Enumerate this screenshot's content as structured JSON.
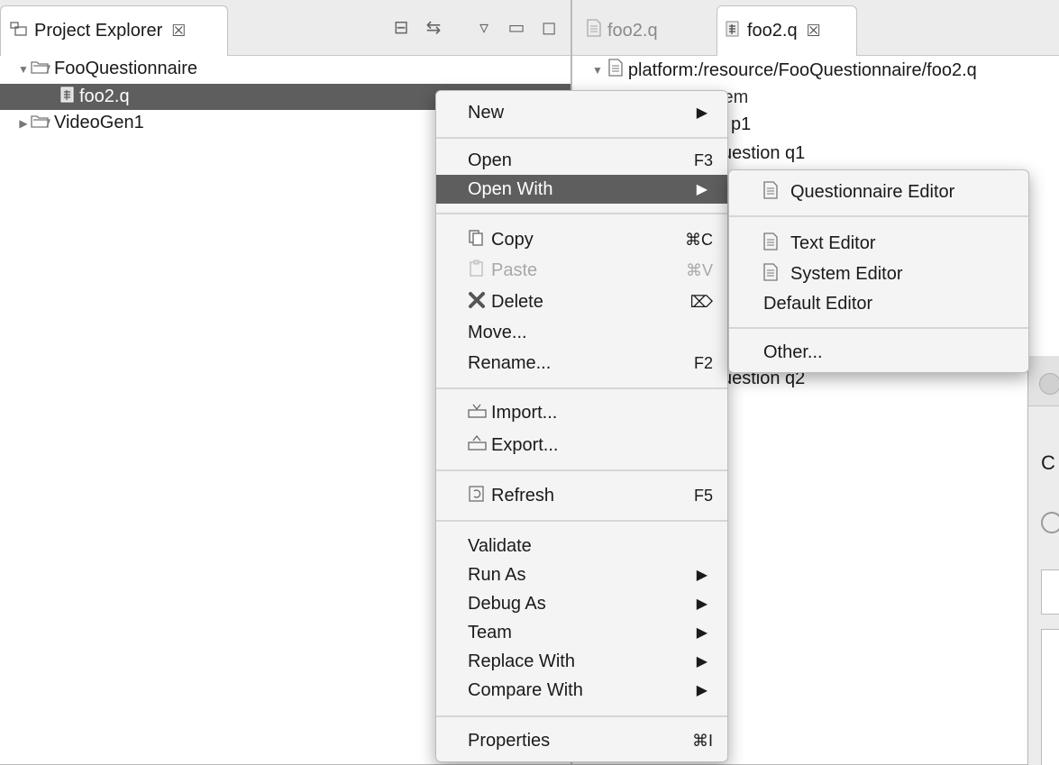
{
  "project_explorer": {
    "tab_label": "Project Explorer",
    "tab_close": "☒",
    "toolbar": {
      "collapse_all": "⊟",
      "link_with_editor": "⇆",
      "view_menu": "▿",
      "minimize": "▭",
      "maximize": "◻"
    },
    "tree": [
      {
        "label": "FooQuestionnaire",
        "arrow": "▼",
        "icon": "folder-icon"
      },
      {
        "label": "foo2.q",
        "icon": "questionnaire-file-icon",
        "selected": true
      },
      {
        "label": "VideoGen1",
        "arrow": "▶",
        "icon": "folder-icon"
      }
    ]
  },
  "editor": {
    "tabs": [
      {
        "label": "foo2.q",
        "active": false
      },
      {
        "label": "foo2.q",
        "active": true,
        "close": "☒"
      }
    ],
    "tree": {
      "root": {
        "arrow": "▼",
        "label": "platform:/resource/FooQuestionnaire/foo2.q"
      },
      "system_fragment": "stem",
      "p1_fragment": "p1",
      "q1_fragment": "uestion q1",
      "q2_fragment": "uestion q2"
    }
  },
  "context_menu": {
    "items": {
      "new": {
        "label": "New",
        "submenu": "▶"
      },
      "open": {
        "label": "Open",
        "shortcut": "F3"
      },
      "open_with": {
        "label": "Open With",
        "submenu": "▶"
      },
      "copy": {
        "label": "Copy",
        "shortcut": "⌘C",
        "icon": "copy-icon"
      },
      "paste": {
        "label": "Paste",
        "shortcut": "⌘V",
        "icon": "paste-icon"
      },
      "delete": {
        "label": "Delete",
        "shortcut": "⌦",
        "icon": "delete-icon"
      },
      "move": {
        "label": "Move..."
      },
      "rename": {
        "label": "Rename...",
        "shortcut": "F2"
      },
      "import": {
        "label": "Import...",
        "icon": "import-icon"
      },
      "export": {
        "label": "Export...",
        "icon": "export-icon"
      },
      "refresh": {
        "label": "Refresh",
        "shortcut": "F5",
        "icon": "refresh-icon"
      },
      "validate": {
        "label": "Validate"
      },
      "run_as": {
        "label": "Run As",
        "submenu": "▶"
      },
      "debug_as": {
        "label": "Debug As",
        "submenu": "▶"
      },
      "team": {
        "label": "Team",
        "submenu": "▶"
      },
      "replace_with": {
        "label": "Replace With",
        "submenu": "▶"
      },
      "compare_with": {
        "label": "Compare With",
        "submenu": "▶"
      },
      "properties": {
        "label": "Properties",
        "shortcut": "⌘I"
      }
    }
  },
  "open_with_menu": {
    "items": {
      "questionnaire_editor": {
        "label": "Questionnaire Editor",
        "icon": "document-icon"
      },
      "text_editor": {
        "label": "Text Editor",
        "icon": "document-icon"
      },
      "system_editor": {
        "label": "System Editor",
        "icon": "document-icon"
      },
      "default_editor": {
        "label": "Default Editor"
      },
      "other": {
        "label": "Other..."
      }
    }
  },
  "dialog_fragment": {
    "heading_fragment": "C"
  },
  "colors": {
    "selection": "#5e5e5e",
    "menu_background": "#f4f4f4",
    "window_background": "#ececec"
  }
}
